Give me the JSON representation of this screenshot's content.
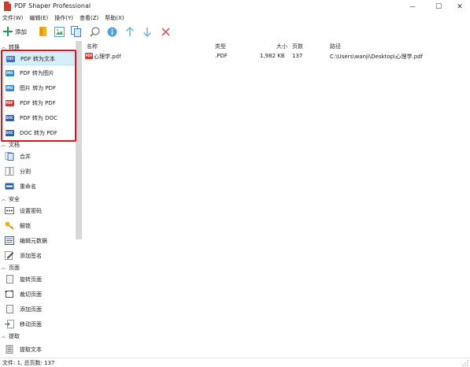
{
  "window": {
    "title": "PDF Shaper Professional",
    "min_glyph": "—",
    "max_glyph": "☐",
    "close_glyph": "✕"
  },
  "menu": [
    "文件(W)",
    "编辑(E)",
    "操作(Y)",
    "查看(Z)",
    "帮助(X)"
  ],
  "toolbar": {
    "add_label": "添加",
    "icons": [
      "plus-icon",
      "folder-icon",
      "image-icon",
      "copy-icon",
      "search-icon",
      "info-icon",
      "arrow-up-icon",
      "arrow-down-icon",
      "remove-icon"
    ]
  },
  "sidebar": {
    "sections": [
      {
        "label": "转换",
        "items": [
          {
            "label": "PDF 转为文本",
            "icon": "pdf-to-text-icon",
            "badge": "TXT"
          },
          {
            "label": "PDF 转为图片",
            "icon": "pdf-to-image-icon",
            "badge": "IMG"
          },
          {
            "label": "图片 转为 PDF",
            "icon": "image-to-pdf-icon",
            "badge": "IMG"
          },
          {
            "label": "PDF 转为 PDF",
            "icon": "pdf-to-pdf-icon",
            "badge": "PDF"
          },
          {
            "label": "PDF 转为 DOC",
            "icon": "pdf-to-doc-icon",
            "badge": "DOC"
          },
          {
            "label": "DOC 转为 PDF",
            "icon": "doc-to-pdf-icon",
            "badge": "DOC"
          }
        ]
      },
      {
        "label": "文档",
        "items": [
          {
            "label": "合并",
            "icon": "merge-icon"
          },
          {
            "label": "分割",
            "icon": "split-icon"
          },
          {
            "label": "重命名",
            "icon": "rename-icon"
          }
        ]
      },
      {
        "label": "安全",
        "items": [
          {
            "label": "设置密码",
            "icon": "password-icon"
          },
          {
            "label": "解锁",
            "icon": "key-icon"
          },
          {
            "label": "编辑元数据",
            "icon": "metadata-icon"
          },
          {
            "label": "添加签名",
            "icon": "signature-icon"
          }
        ]
      },
      {
        "label": "页面",
        "items": [
          {
            "label": "旋转页面",
            "icon": "rotate-icon"
          },
          {
            "label": "裁切页面",
            "icon": "crop-icon"
          },
          {
            "label": "添加页面",
            "icon": "add-page-icon"
          },
          {
            "label": "移动页面",
            "icon": "move-page-icon"
          }
        ]
      },
      {
        "label": "提取",
        "items": [
          {
            "label": "提取文本",
            "icon": "extract-text-icon"
          }
        ]
      }
    ]
  },
  "list": {
    "columns": [
      "名称",
      "类型",
      "大小",
      "页数",
      "路径"
    ],
    "rows": [
      {
        "name": "心理学.pdf",
        "type": ".PDF",
        "size": "1,982 KB",
        "pages": "137",
        "path": "C:\\Users\\wanji\\Desktop\\心理学.pdf"
      }
    ]
  },
  "status": {
    "text": "文件: 1, 总页数: 137"
  },
  "colors": {
    "highlight_box": "#d9141b",
    "selected_bg": "#d6eef8",
    "accent_green": "#1f9c4a",
    "accent_blue": "#4aa3df",
    "remove_red": "#e05555"
  }
}
